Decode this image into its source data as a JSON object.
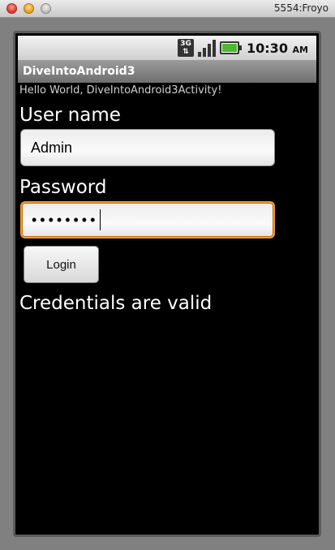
{
  "window": {
    "title": "5554:Froyo"
  },
  "statusbar": {
    "network_label": "3G",
    "time": "10:30",
    "ampm": "AM"
  },
  "app": {
    "title": "DiveIntoAndroid3"
  },
  "content": {
    "greeting": "Hello World, DiveIntoAndroid3Activity!",
    "username_label": "User name",
    "username_value": "Admin",
    "password_label": "Password",
    "password_value": "••••••••",
    "login_label": "Login",
    "result_text": "Credentials are valid"
  },
  "colors": {
    "accent_focus": "#f09a2c",
    "battery_fill": "#4fb82e",
    "screen_bg": "#000000"
  },
  "icons": [
    "close-icon",
    "minimize-icon",
    "maximize-icon",
    "3g-icon",
    "signal-icon",
    "battery-icon"
  ]
}
